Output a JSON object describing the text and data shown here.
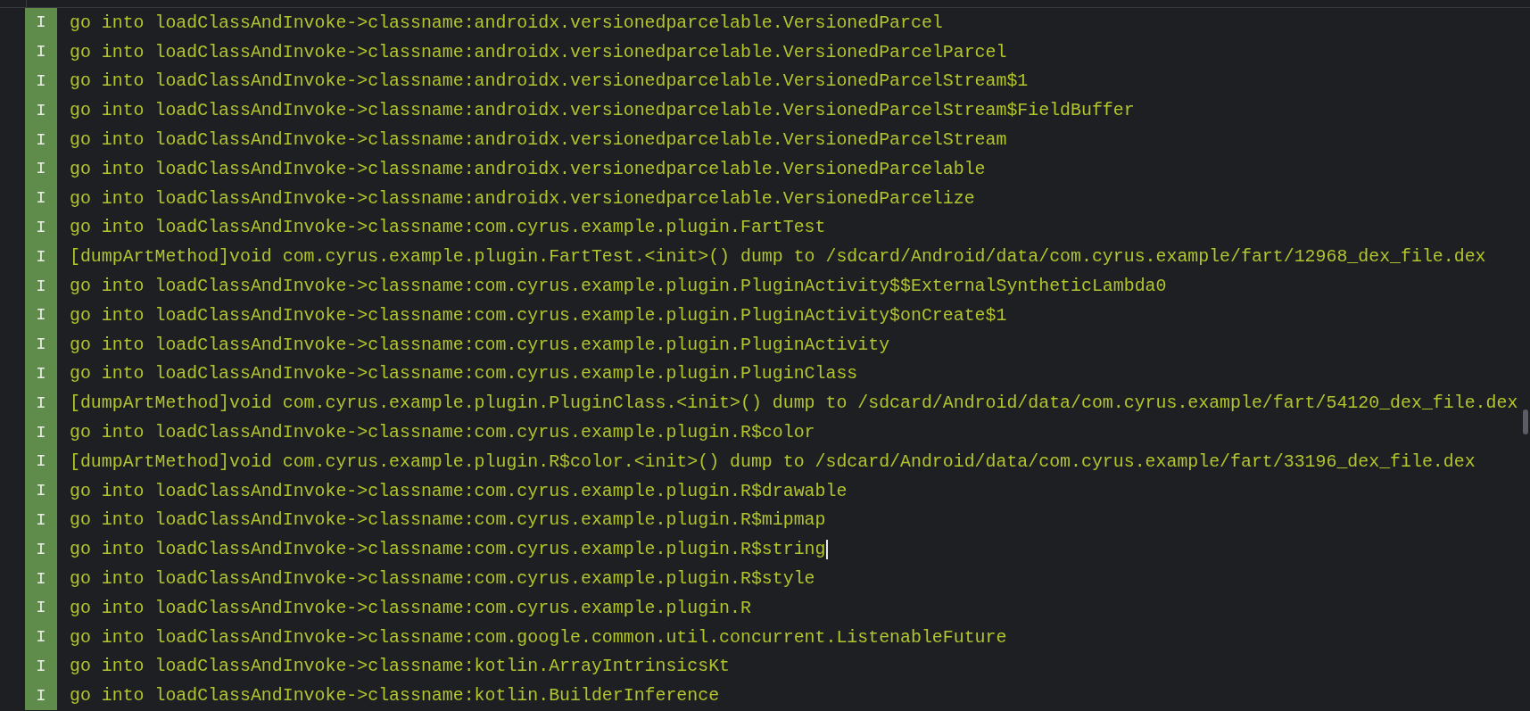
{
  "log": {
    "rows": [
      {
        "tag": "I",
        "text": "go into loadClassAndInvoke->classname:androidx.versionedparcelable.VersionedParcel",
        "caret": false
      },
      {
        "tag": "I",
        "text": "go into loadClassAndInvoke->classname:androidx.versionedparcelable.VersionedParcelParcel",
        "caret": false
      },
      {
        "tag": "I",
        "text": "go into loadClassAndInvoke->classname:androidx.versionedparcelable.VersionedParcelStream$1",
        "caret": false
      },
      {
        "tag": "I",
        "text": "go into loadClassAndInvoke->classname:androidx.versionedparcelable.VersionedParcelStream$FieldBuffer",
        "caret": false
      },
      {
        "tag": "I",
        "text": "go into loadClassAndInvoke->classname:androidx.versionedparcelable.VersionedParcelStream",
        "caret": false
      },
      {
        "tag": "I",
        "text": "go into loadClassAndInvoke->classname:androidx.versionedparcelable.VersionedParcelable",
        "caret": false
      },
      {
        "tag": "I",
        "text": "go into loadClassAndInvoke->classname:androidx.versionedparcelable.VersionedParcelize",
        "caret": false
      },
      {
        "tag": "I",
        "text": "go into loadClassAndInvoke->classname:com.cyrus.example.plugin.FartTest",
        "caret": false
      },
      {
        "tag": "I",
        "text": "[dumpArtMethod]void com.cyrus.example.plugin.FartTest.<init>() dump to /sdcard/Android/data/com.cyrus.example/fart/12968_dex_file.dex",
        "caret": false
      },
      {
        "tag": "I",
        "text": "go into loadClassAndInvoke->classname:com.cyrus.example.plugin.PluginActivity$$ExternalSyntheticLambda0",
        "caret": false
      },
      {
        "tag": "I",
        "text": "go into loadClassAndInvoke->classname:com.cyrus.example.plugin.PluginActivity$onCreate$1",
        "caret": false
      },
      {
        "tag": "I",
        "text": "go into loadClassAndInvoke->classname:com.cyrus.example.plugin.PluginActivity",
        "caret": false
      },
      {
        "tag": "I",
        "text": "go into loadClassAndInvoke->classname:com.cyrus.example.plugin.PluginClass",
        "caret": false
      },
      {
        "tag": "I",
        "text": "[dumpArtMethod]void com.cyrus.example.plugin.PluginClass.<init>() dump to /sdcard/Android/data/com.cyrus.example/fart/54120_dex_file.dex",
        "caret": false
      },
      {
        "tag": "I",
        "text": "go into loadClassAndInvoke->classname:com.cyrus.example.plugin.R$color",
        "caret": false
      },
      {
        "tag": "I",
        "text": "[dumpArtMethod]void com.cyrus.example.plugin.R$color.<init>() dump to /sdcard/Android/data/com.cyrus.example/fart/33196_dex_file.dex",
        "caret": false
      },
      {
        "tag": "I",
        "text": "go into loadClassAndInvoke->classname:com.cyrus.example.plugin.R$drawable",
        "caret": false
      },
      {
        "tag": "I",
        "text": "go into loadClassAndInvoke->classname:com.cyrus.example.plugin.R$mipmap",
        "caret": false
      },
      {
        "tag": "I",
        "text": "go into loadClassAndInvoke->classname:com.cyrus.example.plugin.R$string",
        "caret": true
      },
      {
        "tag": "I",
        "text": "go into loadClassAndInvoke->classname:com.cyrus.example.plugin.R$style",
        "caret": false
      },
      {
        "tag": "I",
        "text": "go into loadClassAndInvoke->classname:com.cyrus.example.plugin.R",
        "caret": false
      },
      {
        "tag": "I",
        "text": "go into loadClassAndInvoke->classname:com.google.common.util.concurrent.ListenableFuture",
        "caret": false
      },
      {
        "tag": "I",
        "text": "go into loadClassAndInvoke->classname:kotlin.ArrayIntrinsicsKt",
        "caret": false
      },
      {
        "tag": "I",
        "text": "go into loadClassAndInvoke->classname:kotlin.BuilderInference",
        "caret": false
      }
    ]
  }
}
